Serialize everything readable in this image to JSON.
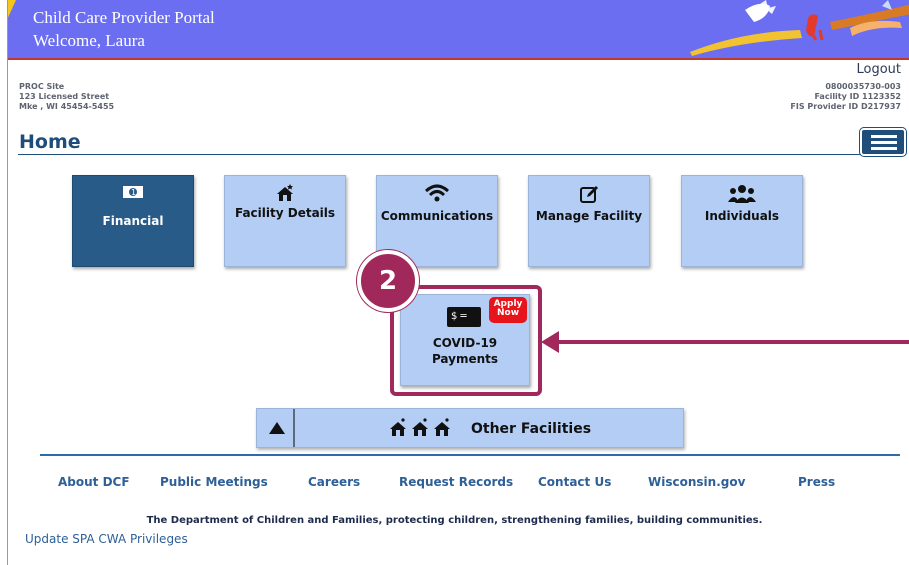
{
  "header": {
    "title": "Child Care Provider Portal",
    "welcome": "Welcome, Laura",
    "logout": "Logout",
    "banner_color": "#6b6ef0"
  },
  "site": {
    "name": "PROC Site",
    "street": "123 Licensed Street",
    "city": "Mke , WI 45454-5455"
  },
  "ids": {
    "account": "0800035730-003",
    "facility": "Facility ID 1123352",
    "fis": "FIS Provider ID D217937"
  },
  "page": {
    "title": "Home"
  },
  "tiles": [
    {
      "label": "Financial",
      "icon": "money-icon",
      "glyph": "▣"
    },
    {
      "label": "Facility Details",
      "icon": "house-icon",
      "glyph": "⌂"
    },
    {
      "label": "Communications",
      "icon": "wifi-icon",
      "glyph": "≋"
    },
    {
      "label": "Manage Facility",
      "icon": "edit-icon",
      "glyph": "✎"
    },
    {
      "label": "Individuals",
      "icon": "people-icon",
      "glyph": "👥"
    }
  ],
  "covid": {
    "line1": "COVID-19",
    "line2": "Payments",
    "badge_line1": "Apply",
    "badge_line2": "Now",
    "pay_glyph": "$ ═"
  },
  "annotation": {
    "step": "2",
    "color": "#a1285a"
  },
  "other": {
    "label": "Other Facilities",
    "icons": "⌂⌂⌂"
  },
  "footer": {
    "links": [
      "About DCF",
      "Public Meetings",
      "Careers",
      "Request Records",
      "Contact Us",
      "Wisconsin.gov",
      "Press"
    ],
    "tagline": "The Department of Children and Families, protecting children, strengthening families, building communities.",
    "update": "Update SPA CWA Privileges"
  }
}
